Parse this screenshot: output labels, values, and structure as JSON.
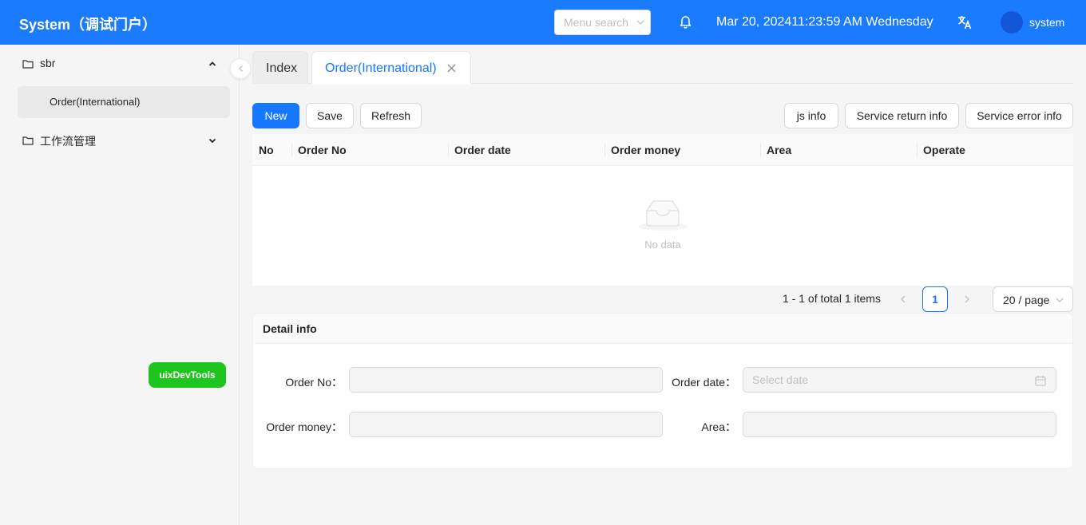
{
  "header": {
    "brand": "System（调试门户）",
    "menu_search_placeholder": "Menu search",
    "datetime": "Mar 20, 202411:23:59 AM Wednesday",
    "username": "system",
    "colors": {
      "header_bg": "#1a7bff",
      "primary": "#1677ff",
      "devtools": "#1fc51f"
    }
  },
  "sidebar": {
    "groups": [
      {
        "label": "sbr",
        "icon": "folder-icon",
        "expanded": true,
        "items": [
          {
            "label": "Order(International)",
            "selected": true
          }
        ]
      },
      {
        "label": "工作流管理",
        "icon": "folder-icon",
        "expanded": false
      }
    ],
    "devtools_label": "uixDevTools"
  },
  "tabs": [
    {
      "label": "Index",
      "active": false
    },
    {
      "label": "Order(International)",
      "active": true,
      "closable": true
    }
  ],
  "toolbar": {
    "new_label": "New",
    "save_label": "Save",
    "refresh_label": "Refresh",
    "js_info_label": "js info",
    "service_return_label": "Service return info",
    "service_error_label": "Service error info"
  },
  "table": {
    "columns": [
      "No",
      "Order No",
      "Order date",
      "Order money",
      "Area",
      "Operate"
    ],
    "rows": [],
    "empty_text": "No data"
  },
  "pagination": {
    "total_text": "1 - 1 of total 1 items",
    "current_page": "1",
    "page_size": "20 / page"
  },
  "detail": {
    "title": "Detail info",
    "fields": {
      "order_no_label": "Order No",
      "order_date_label": "Order date",
      "order_date_placeholder": "Select date",
      "order_money_label": "Order money",
      "area_label": "Area"
    }
  }
}
